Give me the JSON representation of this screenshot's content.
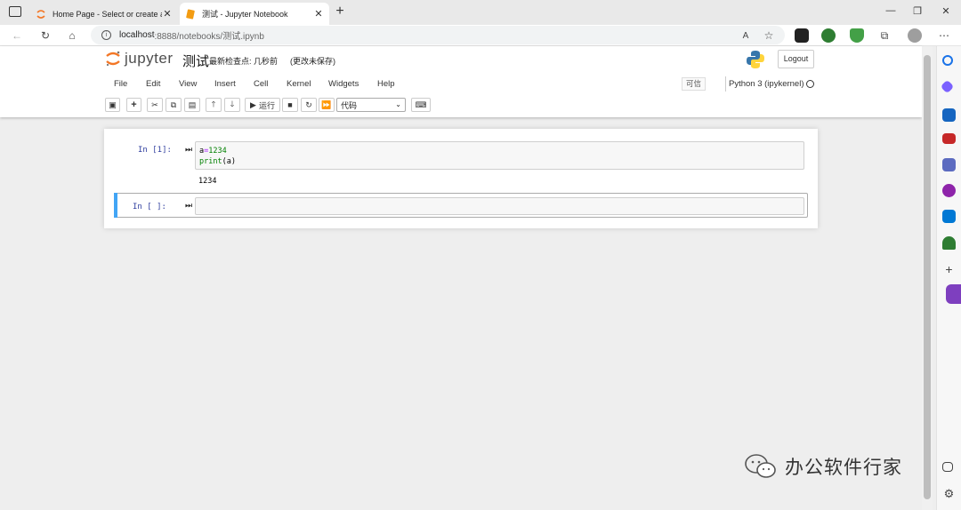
{
  "browser": {
    "tabs": [
      {
        "title": "Home Page - Select or create a n",
        "active": false
      },
      {
        "title": "测试 - Jupyter Notebook",
        "active": true
      }
    ],
    "new_tab_symbol": "+",
    "close_symbol": "✕",
    "url_host": "localhost",
    "url_path": ":8888/notebooks/测试.ipynb",
    "window_controls": [
      "—",
      "❐",
      "✕"
    ]
  },
  "jupyter": {
    "logo_text": "jupyter",
    "notebook_name": "测试",
    "checkpoint": "最新检查点: 几秒前",
    "autosave_status": "(更改未保存)",
    "logout_label": "Logout",
    "menu": [
      "File",
      "Edit",
      "View",
      "Insert",
      "Cell",
      "Kernel",
      "Widgets",
      "Help"
    ],
    "trusted_label": "可信",
    "kernel_name": "Python 3 (ipykernel)",
    "toolbar": {
      "run_label": "运行",
      "cell_type": "代码"
    }
  },
  "cells": [
    {
      "prompt": "In  [1]:",
      "code": [
        "a=1234",
        "print(a)"
      ],
      "output": "1234"
    },
    {
      "prompt": "In  [ ]:",
      "code": [],
      "output": ""
    }
  ],
  "watermark": "办公软件行家",
  "colors": {
    "accent_blue": "#42a5f5",
    "prompt_blue": "#303f9f",
    "jupyter_orange": "#f37726"
  }
}
